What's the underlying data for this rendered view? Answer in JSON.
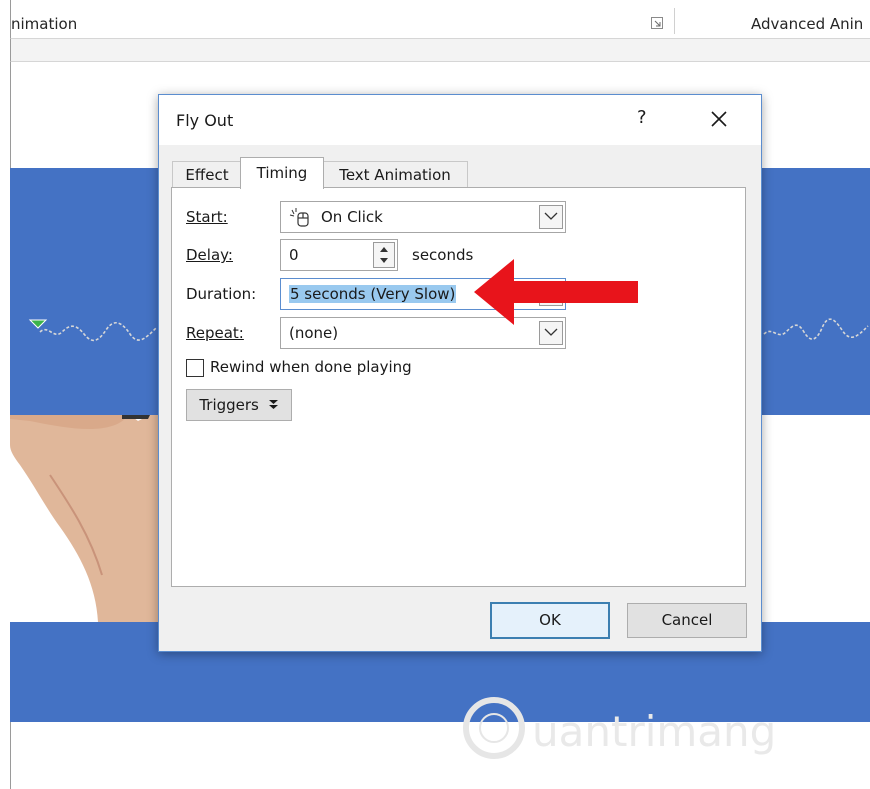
{
  "ribbon": {
    "left_title": "nimation",
    "right_title": "Advanced Anin"
  },
  "dialog": {
    "title": "Fly Out",
    "help_label": "?",
    "tabs": [
      {
        "label": "Effect"
      },
      {
        "label": "Timing"
      },
      {
        "label": "Text Animation"
      }
    ],
    "active_tab": "Timing",
    "fields": {
      "start_label": "Start:",
      "start_value": "On Click",
      "delay_label": "Delay:",
      "delay_value": "0",
      "delay_unit": "seconds",
      "duration_label": "Duration:",
      "duration_value": "5 seconds (Very Slow)",
      "repeat_label": "Repeat:",
      "repeat_value": "(none)"
    },
    "rewind_label": "Rewind when done playing",
    "rewind_checked": false,
    "triggers_label": "Triggers",
    "ok_label": "OK",
    "cancel_label": "Cancel"
  },
  "annotation": {
    "arrow_color": "#e8141b"
  },
  "colors": {
    "slide_band": "#4472c4",
    "dialog_border": "#5b8dcf",
    "selection_highlight": "#99c9ef"
  },
  "watermark": {
    "text": "uantrimang"
  }
}
